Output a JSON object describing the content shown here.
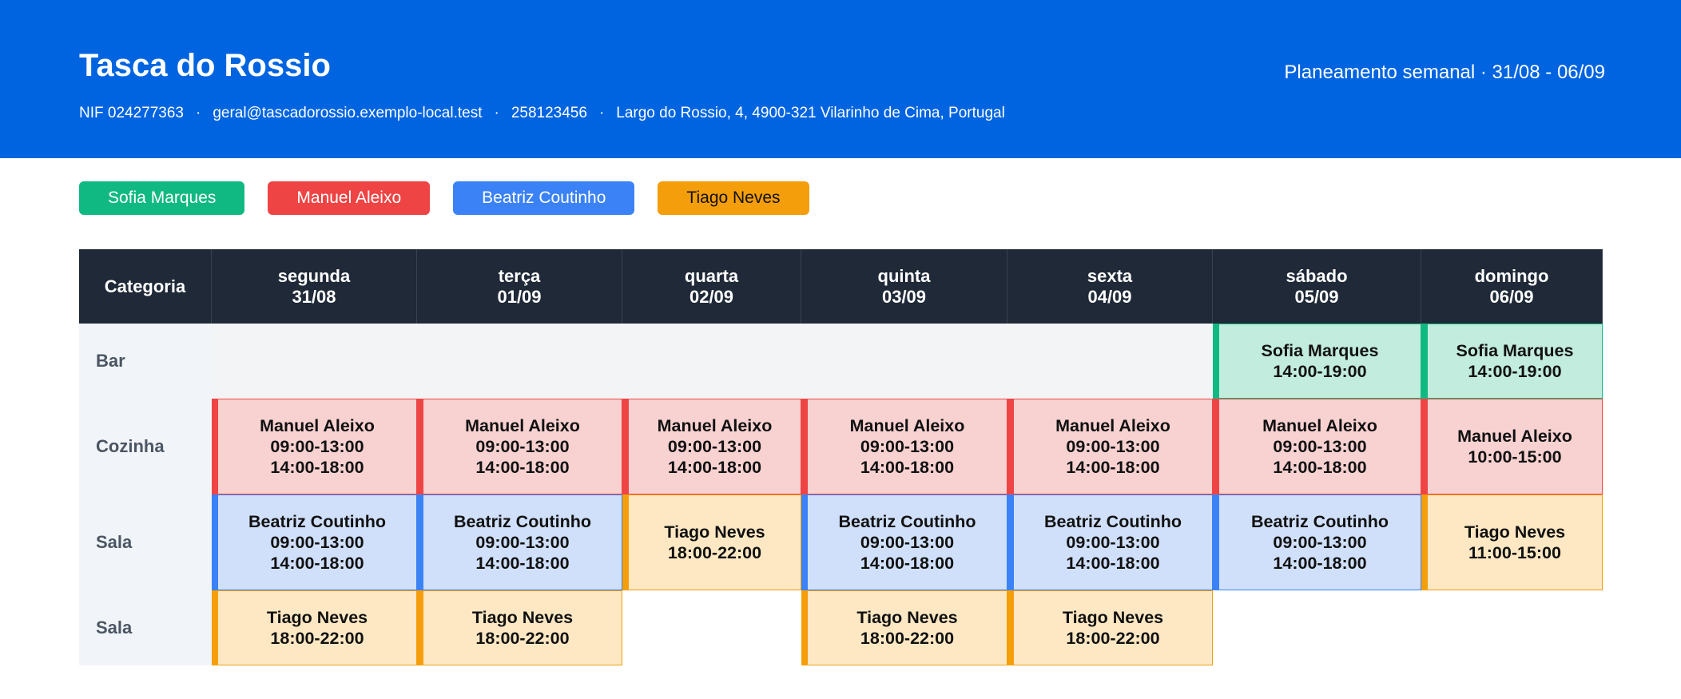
{
  "header": {
    "restaurant_name": "Tasca do Rossio",
    "nif": "NIF 024277363",
    "email": "geral@tascadorossio.exemplo-local.test",
    "phone": "258123456",
    "address": "Largo do Rossio, 4, 4900-321 Vilarinho de Cima, Portugal",
    "separator": "·",
    "plan_title": "Planeamento semanal · 31/08 - 06/09"
  },
  "legend": [
    {
      "name": "Sofia Marques",
      "color": "#10b981",
      "text_color": "#ffffff"
    },
    {
      "name": "Manuel Aleixo",
      "color": "#ef4444",
      "text_color": "#ffffff"
    },
    {
      "name": "Beatriz Coutinho",
      "color": "#3b82f6",
      "text_color": "#ffffff"
    },
    {
      "name": "Tiago Neves",
      "color": "#f59e0b",
      "text_color": "#111111"
    }
  ],
  "table": {
    "category_header": "Categoria",
    "days": [
      {
        "day": "segunda",
        "date": "31/08"
      },
      {
        "day": "terça",
        "date": "01/09"
      },
      {
        "day": "quarta",
        "date": "02/09"
      },
      {
        "day": "quinta",
        "date": "03/09"
      },
      {
        "day": "sexta",
        "date": "04/09"
      },
      {
        "day": "sábado",
        "date": "05/09"
      },
      {
        "day": "domingo",
        "date": "06/09"
      }
    ],
    "rows": [
      {
        "category": "Bar",
        "shade": "grey",
        "cells": [
          null,
          null,
          null,
          null,
          null,
          {
            "name": "Sofia Marques",
            "color": "green",
            "shifts": [
              "14:00-19:00"
            ]
          },
          {
            "name": "Sofia Marques",
            "color": "green",
            "shifts": [
              "14:00-19:00"
            ]
          }
        ]
      },
      {
        "category": "Cozinha",
        "shade": "none",
        "cells": [
          {
            "name": "Manuel Aleixo",
            "color": "red",
            "shifts": [
              "09:00-13:00",
              "14:00-18:00"
            ]
          },
          {
            "name": "Manuel Aleixo",
            "color": "red",
            "shifts": [
              "09:00-13:00",
              "14:00-18:00"
            ]
          },
          {
            "name": "Manuel Aleixo",
            "color": "red",
            "shifts": [
              "09:00-13:00",
              "14:00-18:00"
            ]
          },
          {
            "name": "Manuel Aleixo",
            "color": "red",
            "shifts": [
              "09:00-13:00",
              "14:00-18:00"
            ]
          },
          {
            "name": "Manuel Aleixo",
            "color": "red",
            "shifts": [
              "09:00-13:00",
              "14:00-18:00"
            ]
          },
          {
            "name": "Manuel Aleixo",
            "color": "red",
            "shifts": [
              "09:00-13:00",
              "14:00-18:00"
            ]
          },
          {
            "name": "Manuel Aleixo",
            "color": "red",
            "shifts": [
              "10:00-15:00"
            ]
          }
        ]
      },
      {
        "category": "Sala",
        "shade": "none",
        "cells": [
          {
            "name": "Beatriz Coutinho",
            "color": "blue",
            "shifts": [
              "09:00-13:00",
              "14:00-18:00"
            ]
          },
          {
            "name": "Beatriz Coutinho",
            "color": "blue",
            "shifts": [
              "09:00-13:00",
              "14:00-18:00"
            ]
          },
          {
            "name": "Tiago Neves",
            "color": "orange",
            "shifts": [
              "18:00-22:00"
            ]
          },
          {
            "name": "Beatriz Coutinho",
            "color": "blue",
            "shifts": [
              "09:00-13:00",
              "14:00-18:00"
            ]
          },
          {
            "name": "Beatriz Coutinho",
            "color": "blue",
            "shifts": [
              "09:00-13:00",
              "14:00-18:00"
            ]
          },
          {
            "name": "Beatriz Coutinho",
            "color": "blue",
            "shifts": [
              "09:00-13:00",
              "14:00-18:00"
            ]
          },
          {
            "name": "Tiago Neves",
            "color": "orange",
            "shifts": [
              "11:00-15:00"
            ]
          }
        ]
      },
      {
        "category": "Sala",
        "shade": "none",
        "cells": [
          {
            "name": "Tiago Neves",
            "color": "orange",
            "shifts": [
              "18:00-22:00"
            ]
          },
          {
            "name": "Tiago Neves",
            "color": "orange",
            "shifts": [
              "18:00-22:00"
            ]
          },
          null,
          {
            "name": "Tiago Neves",
            "color": "orange",
            "shifts": [
              "18:00-22:00"
            ]
          },
          {
            "name": "Tiago Neves",
            "color": "orange",
            "shifts": [
              "18:00-22:00"
            ]
          },
          null,
          null
        ]
      }
    ]
  }
}
